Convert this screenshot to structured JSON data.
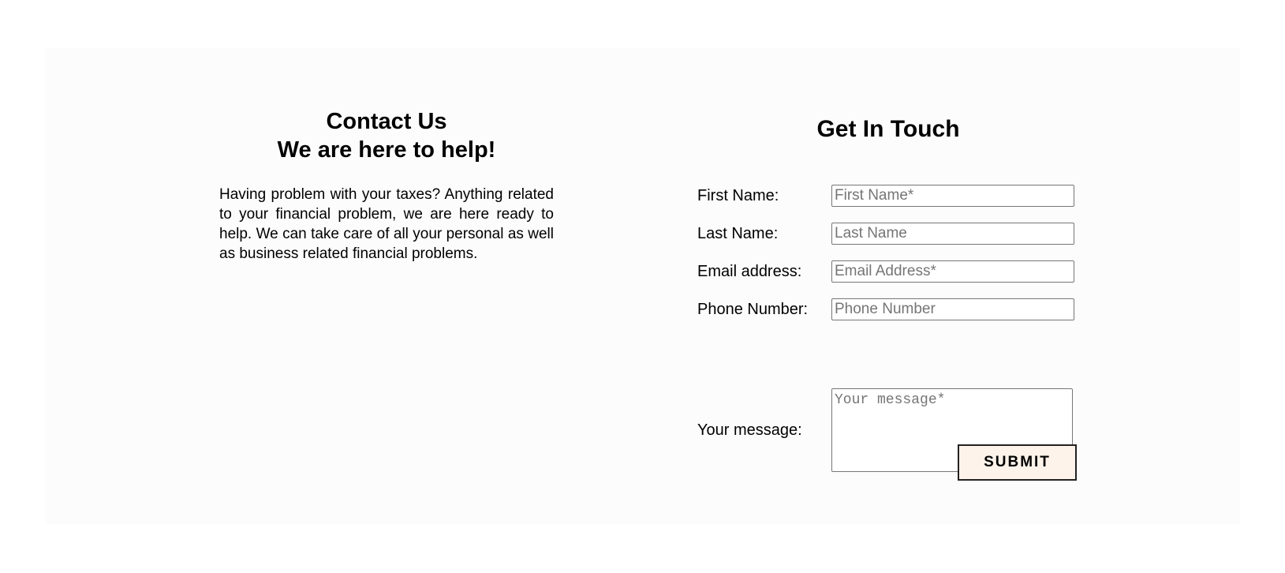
{
  "contact": {
    "heading_line1": "Contact Us",
    "heading_line2": "We are here to help!",
    "description": "Having problem with your taxes? Anything related to your financial problem, we are here ready to help. We can take care of all your personal as well as business related financial problems."
  },
  "form": {
    "title": "Get In Touch",
    "first_name": {
      "label": "First Name:",
      "placeholder": "First Name*"
    },
    "last_name": {
      "label": "Last Name:",
      "placeholder": "Last Name"
    },
    "email": {
      "label": "Email address:",
      "placeholder": "Email Address*"
    },
    "phone": {
      "label": "Phone Number:",
      "placeholder": "Phone Number"
    },
    "message": {
      "label": "Your message:",
      "placeholder": "Your message*"
    },
    "submit_label": "SUBMIT"
  }
}
